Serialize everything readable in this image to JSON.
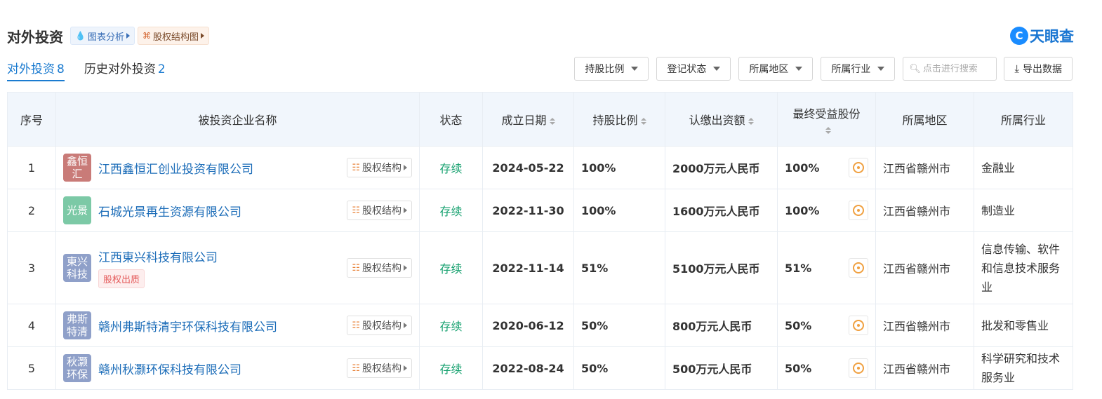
{
  "header": {
    "title": "对外投资",
    "chart_tag": "图表分析",
    "equity_tag": "股权结构图",
    "logo_text": "天眼查"
  },
  "tabs": [
    {
      "label": "对外投资",
      "count": "8"
    },
    {
      "label": "历史对外投资",
      "count": "2"
    }
  ],
  "filters": {
    "shareholding": "持股比例",
    "reg_status": "登记状态",
    "region": "所属地区",
    "industry": "所属行业",
    "search_placeholder": "点击进行搜索",
    "export": "导出数据"
  },
  "table": {
    "headers": {
      "index": "序号",
      "company": "被投资企业名称",
      "status": "状态",
      "date": "成立日期",
      "ratio": "持股比例",
      "capital": "认缴出资额",
      "benefit": "最终受益股份",
      "region": "所属地区",
      "industry": "所属行业"
    },
    "equity_btn": "股权结构",
    "rows": [
      {
        "index": "1",
        "logo": "鑫恒汇",
        "logo_color": "#c97b78",
        "company": "江西鑫恒汇创业投资有限公司",
        "tag": "",
        "status": "存续",
        "date": "2024-05-22",
        "ratio": "100%",
        "capital": "2000万元人民币",
        "benefit": "100%",
        "region": "江西省赣州市",
        "industry": "金融业"
      },
      {
        "index": "2",
        "logo": "光景",
        "logo_color": "#7cc9a6",
        "company": "石城光景再生资源有限公司",
        "tag": "",
        "status": "存续",
        "date": "2022-11-30",
        "ratio": "100%",
        "capital": "1600万元人民币",
        "benefit": "100%",
        "region": "江西省赣州市",
        "industry": "制造业"
      },
      {
        "index": "3",
        "logo": "東兴科技",
        "logo_color": "#8fa0c9",
        "company": "江西東兴科技有限公司",
        "tag": "股权出质",
        "status": "存续",
        "date": "2022-11-14",
        "ratio": "51%",
        "capital": "5100万元人民币",
        "benefit": "51%",
        "region": "江西省赣州市",
        "industry": "信息传输、软件和信息技术服务业"
      },
      {
        "index": "4",
        "logo": "弗斯特清",
        "logo_color": "#8fa0c9",
        "company": "赣州弗斯特清宇环保科技有限公司",
        "tag": "",
        "status": "存续",
        "date": "2020-06-12",
        "ratio": "50%",
        "capital": "800万元人民币",
        "benefit": "50%",
        "region": "江西省赣州市",
        "industry": "批发和零售业"
      },
      {
        "index": "5",
        "logo": "秋灏环保",
        "logo_color": "#8fa0c9",
        "company": "赣州秋灏环保科技有限公司",
        "tag": "",
        "status": "存续",
        "date": "2022-08-24",
        "ratio": "50%",
        "capital": "500万元人民币",
        "benefit": "50%",
        "region": "江西省赣州市",
        "industry": "科学研究和技术服务业"
      }
    ]
  },
  "colors": {
    "accent": "#1b7bd0",
    "status_green": "#14a06e",
    "header_bg": "#f1f6fc"
  }
}
